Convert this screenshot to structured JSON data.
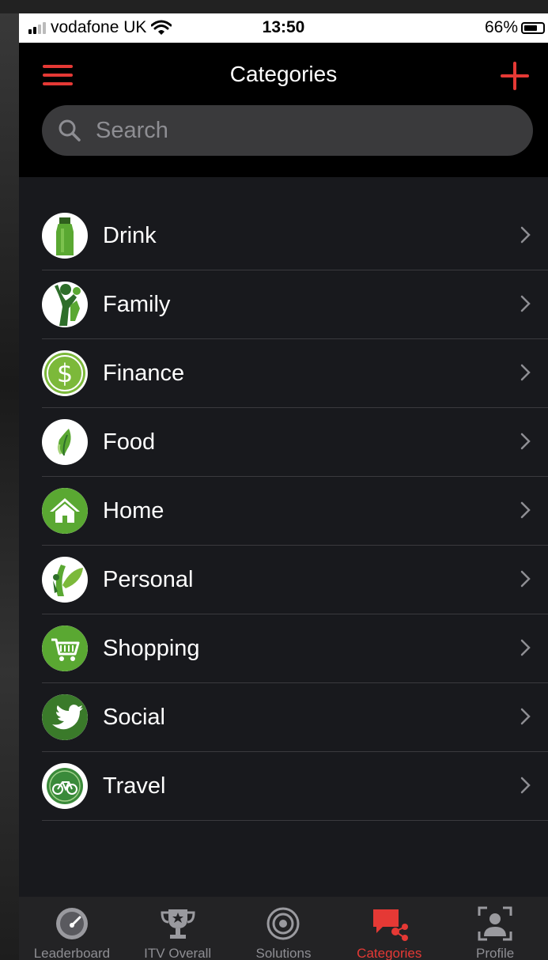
{
  "status": {
    "carrier": "vodafone UK",
    "time": "13:50",
    "battery": "66%"
  },
  "header": {
    "title": "Categories"
  },
  "search": {
    "placeholder": "Search"
  },
  "categories": [
    {
      "label": "Drink",
      "icon": "bottle-icon"
    },
    {
      "label": "Family",
      "icon": "family-icon"
    },
    {
      "label": "Finance",
      "icon": "dollar-icon"
    },
    {
      "label": "Food",
      "icon": "leaf-icon"
    },
    {
      "label": "Home",
      "icon": "house-icon"
    },
    {
      "label": "Personal",
      "icon": "person-leaf-icon"
    },
    {
      "label": "Shopping",
      "icon": "cart-icon"
    },
    {
      "label": "Social",
      "icon": "bird-icon"
    },
    {
      "label": "Travel",
      "icon": "bicycle-icon"
    }
  ],
  "tabs": [
    {
      "label": "Leaderboard",
      "icon": "gauge-icon"
    },
    {
      "label": "ITV Overall",
      "icon": "trophy-icon"
    },
    {
      "label": "Solutions",
      "icon": "refresh-target-icon"
    },
    {
      "label": "Categories",
      "icon": "chat-share-icon",
      "active": true
    },
    {
      "label": "Profile",
      "icon": "profile-frame-icon"
    }
  ],
  "colors": {
    "accent": "#e53935",
    "green": "#5aa832",
    "background": "#18191d"
  }
}
